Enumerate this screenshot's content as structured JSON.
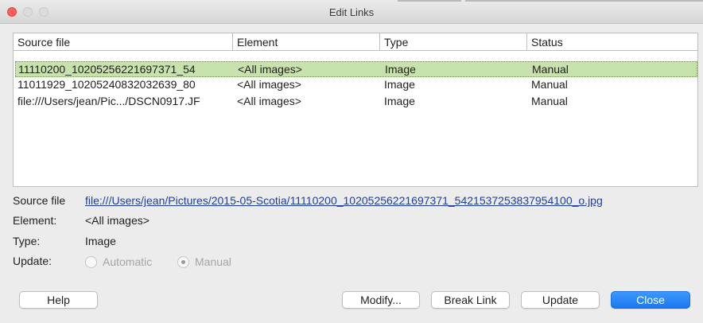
{
  "window": {
    "title": "Edit Links"
  },
  "table": {
    "columns": [
      "Source file",
      "Element",
      "Type",
      "Status"
    ],
    "rows": [
      {
        "source": "11110200_10205256221697371_54",
        "element": "<All images>",
        "type": "Image",
        "status": "Manual",
        "selected": true
      },
      {
        "source": "11011929_10205240832032639_80",
        "element": "<All images>",
        "type": "Image",
        "status": "Manual",
        "selected": false
      },
      {
        "source": "file:///Users/jean/Pic.../DSCN0917.JF",
        "element": "<All images>",
        "type": "Image",
        "status": "Manual",
        "selected": false
      }
    ]
  },
  "details": {
    "source_label": "Source file",
    "source_value": "file:///Users/jean/Pictures/2015-05-Scotia/11110200_10205256221697371_5421537253837954100_o.jpg",
    "element_label": "Element:",
    "element_value": "<All images>",
    "type_label": "Type:",
    "type_value": "Image",
    "update_label": "Update:",
    "update_options": {
      "automatic": "Automatic",
      "manual": "Manual"
    },
    "update_selected": "Manual"
  },
  "buttons": {
    "help": "Help",
    "modify": "Modify...",
    "break_link": "Break Link",
    "update": "Update",
    "close": "Close"
  },
  "colors": {
    "selected_row": "#c8e2ad",
    "link": "#1f3e9c",
    "primary_button": "#1a78f0",
    "close_dot": "#fc5f57"
  }
}
